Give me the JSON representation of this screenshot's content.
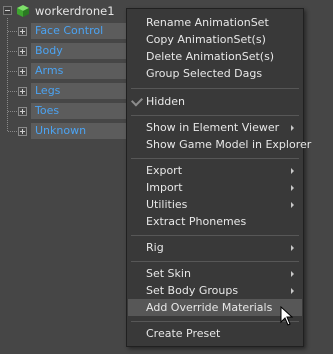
{
  "tree": {
    "root_label": "workerdrone1",
    "children": [
      "Face Control",
      "Body",
      "Arms",
      "Legs",
      "Toes",
      "Unknown"
    ]
  },
  "menu": {
    "rename": "Rename AnimationSet",
    "copy": "Copy AnimationSet(s)",
    "delete": "Delete AnimationSet(s)",
    "group": "Group Selected Dags",
    "hidden": "Hidden",
    "show_element_viewer": "Show in Element Viewer",
    "show_game_model": "Show Game Model in Explorer",
    "export": "Export",
    "import": "Import",
    "utilities": "Utilities",
    "extract_phonemes": "Extract Phonemes",
    "rig": "Rig",
    "set_skin": "Set Skin",
    "set_body_groups": "Set Body Groups",
    "add_override_materials": "Add Override Materials",
    "create_preset": "Create Preset"
  },
  "icons": {
    "root_node": "green-cube-icon",
    "submenu": "chevron-right-icon",
    "hidden_check": "check-icon",
    "cursor": "mouse-pointer-icon"
  },
  "colors": {
    "child_label": "#4ba3f2",
    "menu_bg": "#393939",
    "highlight": "#575757"
  }
}
